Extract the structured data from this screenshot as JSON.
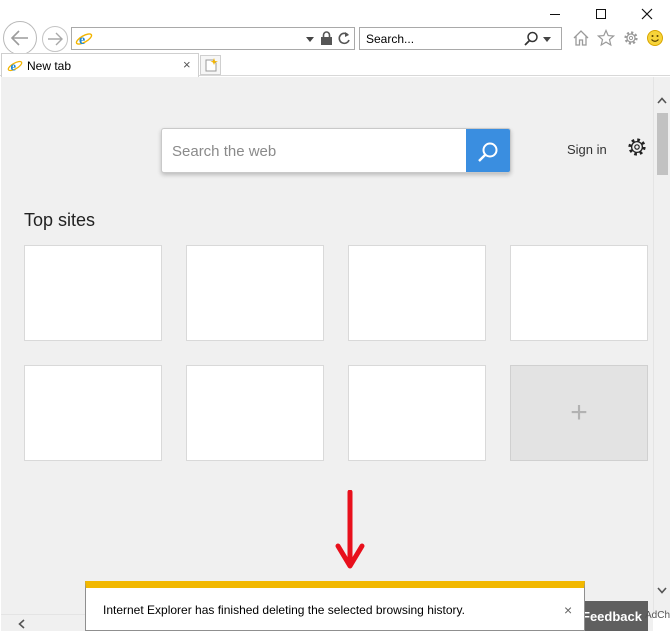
{
  "window": {
    "minimize_icon": "minimize-icon",
    "maximize_icon": "maximize-icon",
    "close_icon": "close-icon"
  },
  "navbar": {
    "address_value": "",
    "search_placeholder": "Search...",
    "icons": [
      "back-arrow-icon",
      "forward-arrow-icon",
      "ie-logo-icon",
      "lock-icon",
      "refresh-icon",
      "search-icon",
      "home-icon",
      "star-icon",
      "gear-icon",
      "smiley-icon"
    ]
  },
  "tabs": [
    {
      "label": "New tab",
      "close": "×"
    }
  ],
  "new_tab_page": {
    "search_placeholder": "Search the web",
    "sign_in": "Sign in",
    "top_sites_title": "Top sites",
    "add_tile_symbol": "+"
  },
  "footer": {
    "feedback_label": "Feedback",
    "adchoices_label": "AdCh"
  },
  "notification": {
    "message": "Internet Explorer has finished deleting the selected browsing history.",
    "close": "×",
    "accent_color": "#f2b800"
  },
  "colors": {
    "search_button": "#3a8ee0",
    "annotation_arrow": "#e8101c",
    "content_background": "#f0f0f0"
  }
}
